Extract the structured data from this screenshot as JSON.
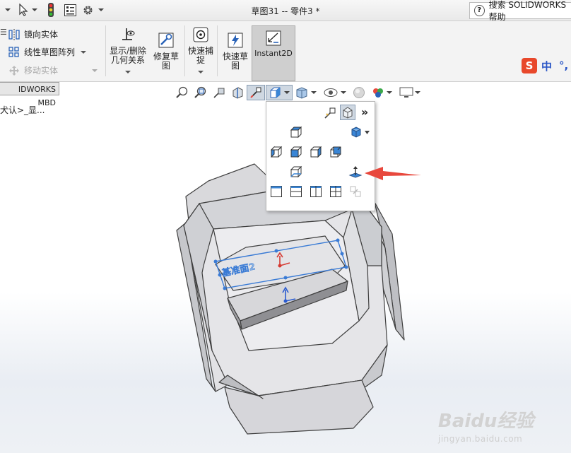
{
  "titlebar": {
    "document_title": "草图31 -- 零件3 *",
    "search_placeholder": "搜索 SOLIDWORKS 帮助",
    "help_glyph": "?"
  },
  "ribbon": {
    "mirror_entity": "镜向实体",
    "linear_pattern": "线性草图阵列",
    "move_entity": "移动实体",
    "show_delete_relations": [
      "显示/删除",
      "几何关系"
    ],
    "repair_sketch": [
      "修复草",
      "图"
    ],
    "quick_snaps": [
      "快速捕",
      "捉"
    ],
    "rapid_sketch": [
      "快速草",
      "图"
    ],
    "instant2d": "Instant2D"
  },
  "sogou": {
    "logo": "S",
    "mode": "中",
    "punct": "°,"
  },
  "sidebar": {
    "mbd_tab": "IDWORKS MBD",
    "tree_text": "犬认>_显..."
  },
  "model": {
    "plane_label": "基准面2"
  },
  "popup": {
    "more_glyph": "»"
  },
  "watermark": {
    "main": "Baidu经验",
    "sub": "jingyan.baidu.com"
  },
  "colors": {
    "accent_blue": "#1e6fd9",
    "arrow_red": "#e8483d",
    "plane_blue": "#3a7bd5"
  }
}
